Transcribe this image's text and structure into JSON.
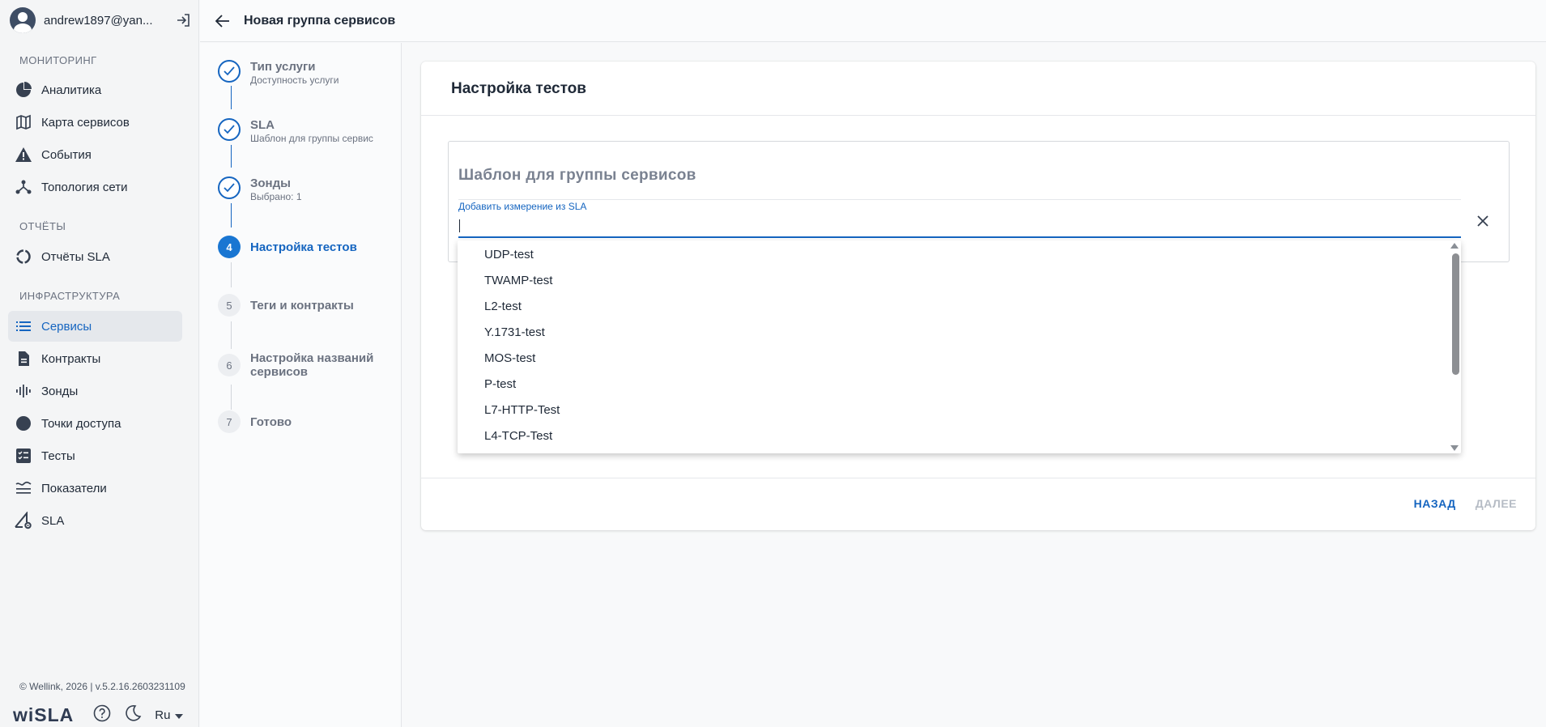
{
  "user": {
    "name": "andrew1897@yan..."
  },
  "sidebar": {
    "sections": [
      {
        "title": "МОНИТОРИНГ"
      },
      {
        "title": "ОТЧЁТЫ"
      },
      {
        "title": "ИНФРАСТРУКТУРА"
      }
    ],
    "items": [
      {
        "label": "Аналитика",
        "icon": "pie-chart-icon"
      },
      {
        "label": "Карта сервисов",
        "icon": "map-icon"
      },
      {
        "label": "События",
        "icon": "warning-icon"
      },
      {
        "label": "Топология сети",
        "icon": "topology-icon"
      },
      {
        "label": "Отчёты SLA",
        "icon": "reports-icon"
      },
      {
        "label": "Сервисы",
        "icon": "list-icon",
        "active": true
      },
      {
        "label": "Контракты",
        "icon": "document-icon"
      },
      {
        "label": "Зонды",
        "icon": "probe-icon"
      },
      {
        "label": "Точки доступа",
        "icon": "circle-icon"
      },
      {
        "label": "Тесты",
        "icon": "checklist-icon"
      },
      {
        "label": "Показатели",
        "icon": "metrics-icon"
      },
      {
        "label": "SLA",
        "icon": "sla-gear-icon"
      }
    ],
    "footer": "© Wellink, 2026 | v.5.2.16.2603231109",
    "logo": "wiSLA",
    "language": "Ru"
  },
  "header": {
    "title": "Новая группа сервисов"
  },
  "stepper": {
    "steps": [
      {
        "number": "1",
        "label": "Тип услуги",
        "sub": "Доступность услуги",
        "state": "done"
      },
      {
        "number": "2",
        "label": "SLA",
        "sub": "Шаблон для группы сервис",
        "state": "done"
      },
      {
        "number": "3",
        "label": "Зонды",
        "sub": "Выбрано: 1",
        "state": "done"
      },
      {
        "number": "4",
        "label": "Настройка тестов",
        "sub": "",
        "state": "current"
      },
      {
        "number": "5",
        "label": "Теги и контракты",
        "sub": "",
        "state": "pending"
      },
      {
        "number": "6",
        "label": "Настройка названий сервисов",
        "sub": "",
        "state": "pending"
      },
      {
        "number": "7",
        "label": "Готово",
        "sub": "",
        "state": "pending"
      }
    ]
  },
  "card": {
    "title": "Настройка тестов",
    "template_title": "Шаблон для группы сервисов",
    "field_label": "Добавить измерение из SLA",
    "field_value": "",
    "back_label": "НАЗАД",
    "next_label": "ДАЛЕЕ"
  },
  "dropdown": {
    "options": [
      "UDP-test",
      "TWAMP-test",
      "L2-test",
      "Y.1731-test",
      "MOS-test",
      "P-test",
      "L7-HTTP-Test",
      "L4-TCP-Test"
    ]
  },
  "colors": {
    "accent": "#1565c0",
    "current_step": "#1976d2",
    "disabled": "#b6bcc5"
  }
}
